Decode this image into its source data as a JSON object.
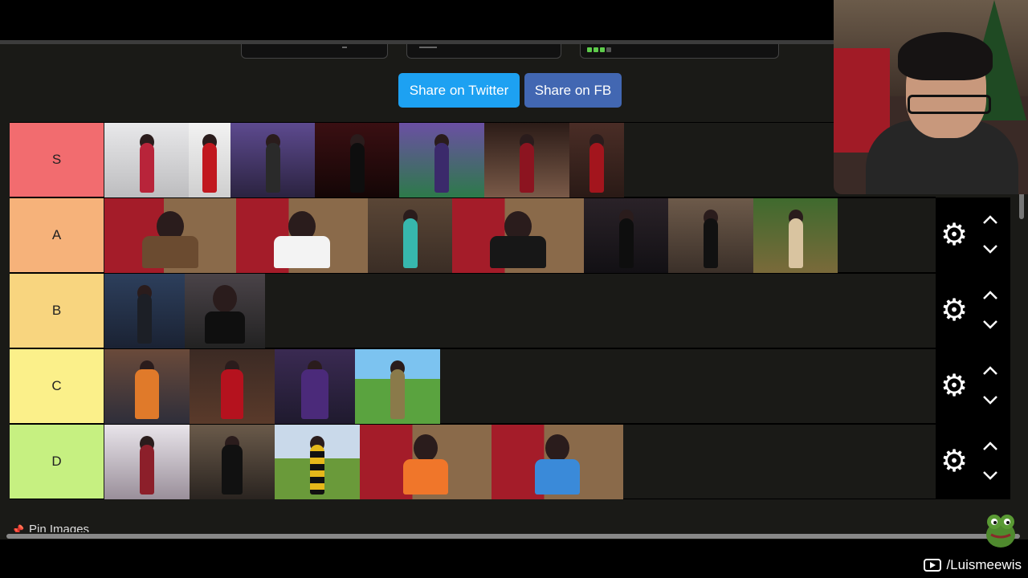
{
  "share": {
    "twitter_label": "Share on Twitter",
    "fb_label": "Share on FB"
  },
  "tiers": [
    {
      "label": "S",
      "color": "#f26c6f"
    },
    {
      "label": "A",
      "color": "#f6b27a"
    },
    {
      "label": "B",
      "color": "#f8d57f"
    },
    {
      "label": "C",
      "color": "#fbf08a"
    },
    {
      "label": "D",
      "color": "#c6f081"
    }
  ],
  "tier_images": {
    "S": [
      "cosplay-crop-top",
      "cosplay-red-dress",
      "cosplay-gamer-room",
      "cosplay-black-bodysuit",
      "cosplay-raven",
      "cosplay-red-ribbons"
    ],
    "A": [
      "cosplay-brown-jacket",
      "cosplay-nurse",
      "cosplay-miku",
      "cosplay-cat-ears",
      "cosplay-dark-outfit",
      "cosplay-maid",
      "cosplay-moana"
    ],
    "B": [
      "cosplay-soldier",
      "cosplay-bunny"
    ],
    "C": [
      "cosplay-charmander",
      "cosplay-santa",
      "cosplay-witch",
      "cosplay-golden-armor"
    ],
    "D": [
      "cosplay-casual",
      "cosplay-nun",
      "cosplay-bee",
      "cosplay-orange-k-shirt",
      "cosplay-vaporeon"
    ]
  },
  "icons": {
    "settings": "gear-icon",
    "move_up": "chevron-up-icon",
    "move_down": "chevron-down-icon",
    "pin": "pin-icon",
    "youtube": "youtube-icon"
  },
  "pin_label": "Pin Images",
  "channel": "/Luismeewis"
}
